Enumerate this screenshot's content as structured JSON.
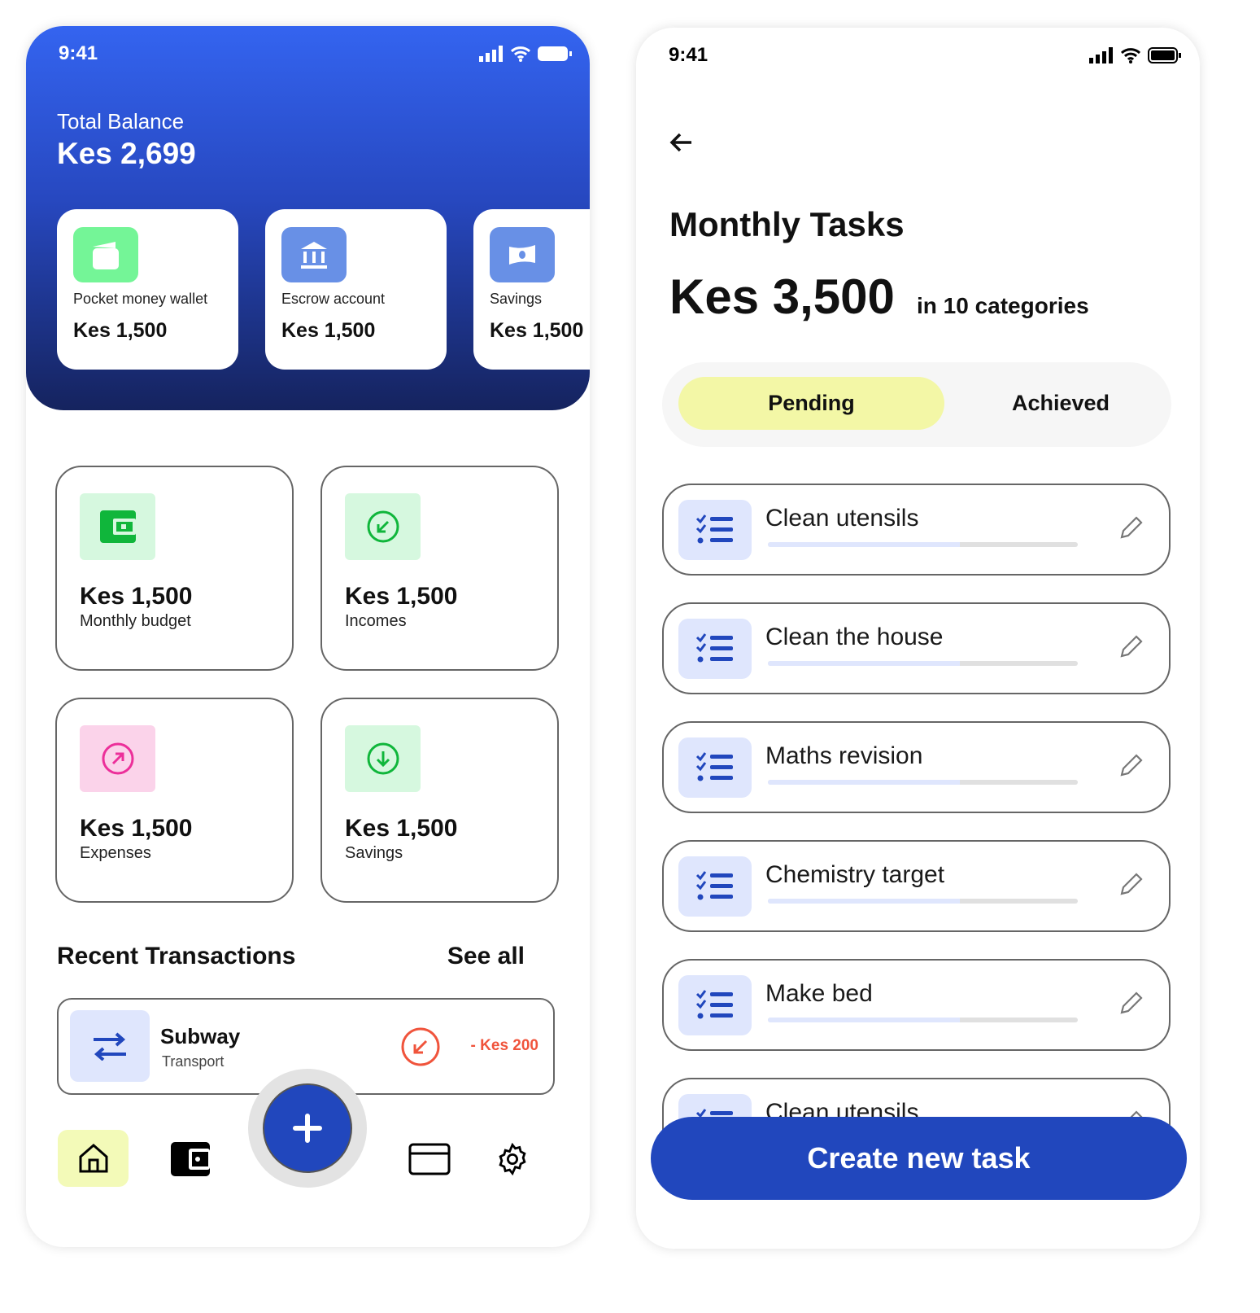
{
  "left": {
    "status": {
      "time": "9:41"
    },
    "total_balance": {
      "label": "Total Balance",
      "value": "Kes 2,699"
    },
    "accounts": [
      {
        "name": "Pocket money wallet",
        "value": "Kes 1,500",
        "icon": "wallet-icon",
        "color": "#74f597"
      },
      {
        "name": "Escrow account",
        "value": "Kes 1,500",
        "icon": "bank-icon",
        "color": "#6890e6"
      },
      {
        "name": "Savings",
        "value": "Kes 1,500",
        "icon": "cash-icon",
        "color": "#6890e6"
      }
    ],
    "stats": [
      {
        "value": "Kes 1,500",
        "label": "Monthly budget",
        "icon": "wallet-icon"
      },
      {
        "value": "Kes 1,500",
        "label": "Incomes",
        "icon": "arrow-down-left-circle-icon"
      },
      {
        "value": "Kes 1,500",
        "label": "Expenses",
        "icon": "arrow-up-right-circle-icon"
      },
      {
        "value": "Kes 1,500",
        "label": "Savings",
        "icon": "arrow-down-circle-icon"
      }
    ],
    "recent": {
      "title": "Recent Transactions",
      "see_all": "See all"
    },
    "transaction": {
      "name": "Subway",
      "category": "Transport",
      "amount": "- Kes 200",
      "icon": "transfer-icon"
    },
    "nav": [
      "home-icon",
      "wallet-icon",
      "plus-icon",
      "card-icon",
      "gear-icon"
    ]
  },
  "right": {
    "status": {
      "time": "9:41"
    },
    "title": "Monthly Tasks",
    "amount": "Kes 3,500",
    "categories": "in 10 categories",
    "tabs": {
      "pending": "Pending",
      "achieved": "Achieved",
      "active": "pending"
    },
    "tasks": [
      {
        "name": "Clean utensils",
        "progress": 0.62
      },
      {
        "name": "Clean the house",
        "progress": 0.62
      },
      {
        "name": "Maths revision",
        "progress": 0.62
      },
      {
        "name": "Chemistry target",
        "progress": 0.62
      },
      {
        "name": "Make bed",
        "progress": 0.62
      },
      {
        "name": "Clean utensils",
        "progress": 0.62
      }
    ],
    "create_button": "Create new task"
  }
}
